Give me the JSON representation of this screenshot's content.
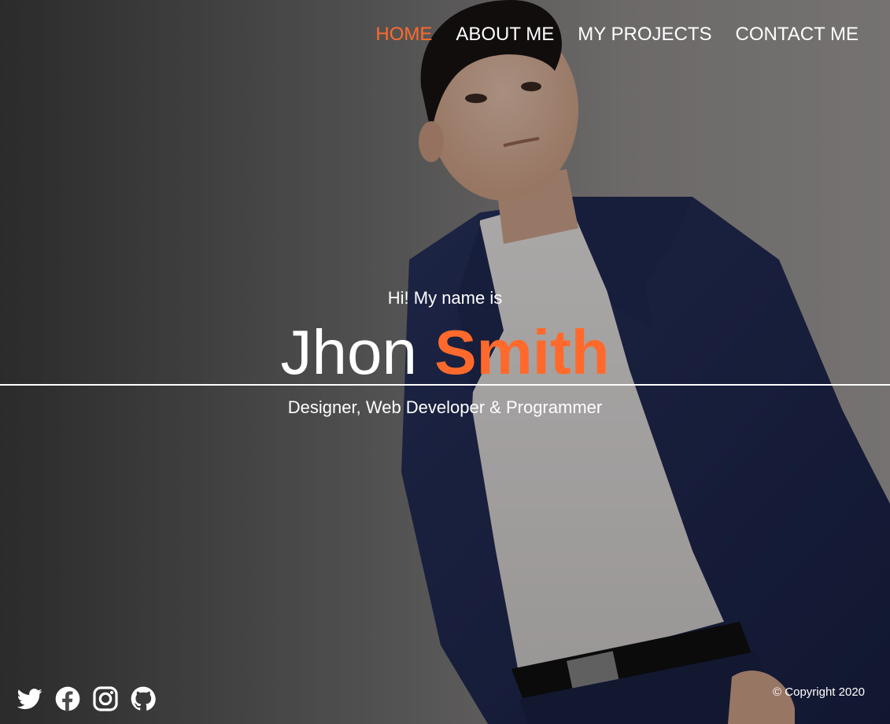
{
  "nav": {
    "items": [
      {
        "label": "HOME",
        "active": true
      },
      {
        "label": "ABOUT ME",
        "active": false
      },
      {
        "label": "MY PROJECTS",
        "active": false
      },
      {
        "label": "CONTACT ME",
        "active": false
      }
    ]
  },
  "hero": {
    "greeting": "Hi! My name is",
    "first_name": "Jhon",
    "last_name": "Smith",
    "tagline": "Designer, Web Developer & Programmer"
  },
  "social": {
    "icons": [
      "twitter-icon",
      "facebook-icon",
      "instagram-icon",
      "github-icon"
    ]
  },
  "footer": {
    "copyright": "© Copyright 2020"
  },
  "colors": {
    "accent": "#ff6a2c",
    "text": "#ffffff"
  }
}
